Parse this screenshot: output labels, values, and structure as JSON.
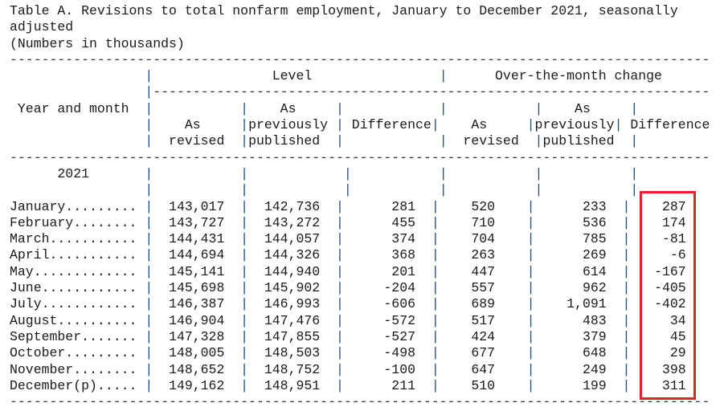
{
  "title": {
    "line1": "Table A. Revisions to total nonfarm employment, January to December 2021, seasonally",
    "line2": "adjusted",
    "units": "(Numbers in thousands)"
  },
  "headers": {
    "stub": "Year and month",
    "group_level": "Level",
    "group_change": "Over-the-month change",
    "as_revised": [
      "As",
      "revised"
    ],
    "as_previously_published": [
      "As",
      "previously",
      "published"
    ],
    "difference": "Difference",
    "year_label": "2021"
  },
  "rows": [
    {
      "month": "January",
      "level_revised": "143,017",
      "level_prev": "142,736",
      "level_diff": "281",
      "chg_revised": "520",
      "chg_prev": "233",
      "chg_diff": "287"
    },
    {
      "month": "February",
      "level_revised": "143,727",
      "level_prev": "143,272",
      "level_diff": "455",
      "chg_revised": "710",
      "chg_prev": "536",
      "chg_diff": "174"
    },
    {
      "month": "March",
      "level_revised": "144,431",
      "level_prev": "144,057",
      "level_diff": "374",
      "chg_revised": "704",
      "chg_prev": "785",
      "chg_diff": "-81"
    },
    {
      "month": "April",
      "level_revised": "144,694",
      "level_prev": "144,326",
      "level_diff": "368",
      "chg_revised": "263",
      "chg_prev": "269",
      "chg_diff": "-6"
    },
    {
      "month": "May",
      "level_revised": "145,141",
      "level_prev": "144,940",
      "level_diff": "201",
      "chg_revised": "447",
      "chg_prev": "614",
      "chg_diff": "-167"
    },
    {
      "month": "June",
      "level_revised": "145,698",
      "level_prev": "145,902",
      "level_diff": "-204",
      "chg_revised": "557",
      "chg_prev": "962",
      "chg_diff": "-405"
    },
    {
      "month": "July",
      "level_revised": "146,387",
      "level_prev": "146,993",
      "level_diff": "-606",
      "chg_revised": "689",
      "chg_prev": "1,091",
      "chg_diff": "-402"
    },
    {
      "month": "August",
      "level_revised": "146,904",
      "level_prev": "147,476",
      "level_diff": "-572",
      "chg_revised": "517",
      "chg_prev": "483",
      "chg_diff": "34"
    },
    {
      "month": "September",
      "level_revised": "147,328",
      "level_prev": "147,855",
      "level_diff": "-527",
      "chg_revised": "424",
      "chg_prev": "379",
      "chg_diff": "45"
    },
    {
      "month": "October",
      "level_revised": "148,005",
      "level_prev": "148,503",
      "level_diff": "-498",
      "chg_revised": "677",
      "chg_prev": "648",
      "chg_diff": "29"
    },
    {
      "month": "November",
      "level_revised": "148,652",
      "level_prev": "148,752",
      "level_diff": "-100",
      "chg_revised": "647",
      "chg_prev": "249",
      "chg_diff": "398"
    },
    {
      "month": "December(p)",
      "level_revised": "149,162",
      "level_prev": "148,951",
      "level_diff": "211",
      "chg_revised": "510",
      "chg_prev": "199",
      "chg_diff": "311"
    }
  ],
  "highlight": {
    "column": "Over-the-month change Difference",
    "color": "#e8202a"
  }
}
